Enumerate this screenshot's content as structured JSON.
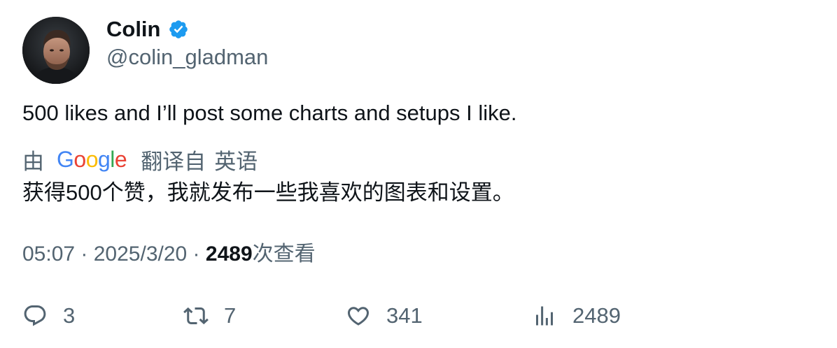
{
  "author": {
    "display_name": "Colin",
    "handle": "@colin_gladman",
    "avatar_icon": "profile-photo",
    "verified_icon": "verified-badge-icon",
    "verified_color": "#1d9bf0"
  },
  "tweet": {
    "text": "500 likes and I’ll post some charts and setups I like."
  },
  "translation": {
    "by_label": "由",
    "provider": "Google",
    "translated_from_label": "翻译自",
    "source_language": "英语",
    "translated_text": "获得500个赞，我就发布一些我喜欢的图表和设置。"
  },
  "meta": {
    "time": "05:07",
    "separator": " · ",
    "date": "2025/3/20",
    "views_count": "2489",
    "views_label": "次查看"
  },
  "actions": {
    "reply": {
      "count": "3",
      "icon": "reply-icon"
    },
    "repost": {
      "count": "7",
      "icon": "repost-icon"
    },
    "like": {
      "count": "341",
      "icon": "heart-icon"
    },
    "views": {
      "count": "2489",
      "icon": "analytics-icon"
    }
  },
  "colors": {
    "text_primary": "#0f1419",
    "text_secondary": "#536471",
    "google_blue": "#4285F4",
    "google_red": "#EA4335",
    "google_yellow": "#FBBC05",
    "google_green": "#34A853"
  }
}
